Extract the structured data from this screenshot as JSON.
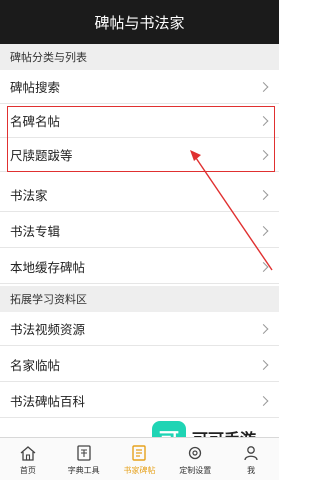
{
  "header": {
    "title": "碑帖与书法家"
  },
  "sections": [
    {
      "title": "碑帖分类与列表",
      "items": [
        {
          "label": "碑帖搜索"
        },
        {
          "label": "名碑名帖"
        },
        {
          "label": "尺牍题跋等"
        },
        {
          "label": "书法家"
        },
        {
          "label": "书法专辑"
        },
        {
          "label": "本地缓存碑帖"
        }
      ]
    },
    {
      "title": "拓展学习资料区",
      "items": [
        {
          "label": "书法视频资源"
        },
        {
          "label": "名家临帖"
        },
        {
          "label": "书法碑帖百科"
        }
      ]
    }
  ],
  "watermark": {
    "logo": "可",
    "text": "可可手游"
  },
  "tabbar": {
    "active_color": "#e6a11c",
    "tabs": [
      {
        "label": "首页",
        "icon": "home-icon"
      },
      {
        "label": "字典工具",
        "icon": "dictionary-icon"
      },
      {
        "label": "书家碑帖",
        "icon": "stele-icon",
        "active": true
      },
      {
        "label": "定制设置",
        "icon": "settings-icon"
      },
      {
        "label": "我",
        "icon": "user-icon"
      }
    ]
  },
  "colors": {
    "header_bg": "#1b1b1b",
    "section_bg": "#eeeeee",
    "highlight": "#e03030"
  }
}
